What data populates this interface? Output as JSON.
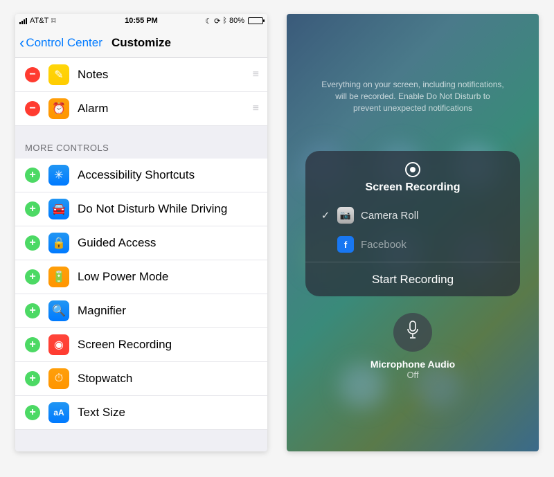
{
  "left": {
    "status": {
      "carrier": "AT&T",
      "time": "10:55 PM",
      "battery_pct": "80%"
    },
    "nav": {
      "back_label": "Control Center",
      "title": "Customize"
    },
    "included": [
      {
        "label": "Notes",
        "icon_color": "yellow",
        "glyph": "✎"
      },
      {
        "label": "Alarm",
        "icon_color": "orange",
        "glyph": "⏰"
      }
    ],
    "more_header": "MORE CONTROLS",
    "more": [
      {
        "label": "Accessibility Shortcuts",
        "icon_color": "blue",
        "glyph": "✳"
      },
      {
        "label": "Do Not Disturb While Driving",
        "icon_color": "blue",
        "glyph": "🚘"
      },
      {
        "label": "Guided Access",
        "icon_color": "blue",
        "glyph": "🔒"
      },
      {
        "label": "Low Power Mode",
        "icon_color": "orange",
        "glyph": "🔋"
      },
      {
        "label": "Magnifier",
        "icon_color": "blue",
        "glyph": "🔍"
      },
      {
        "label": "Screen Recording",
        "icon_color": "red",
        "glyph": "◉"
      },
      {
        "label": "Stopwatch",
        "icon_color": "orange",
        "glyph": "⏱"
      },
      {
        "label": "Text Size",
        "icon_color": "blue",
        "glyph": "aA"
      }
    ]
  },
  "right": {
    "hint": "Everything on your screen, including notifications, will be recorded. Enable Do Not Disturb to prevent unexpected notifications",
    "panel_title": "Screen Recording",
    "destinations": [
      {
        "label": "Camera Roll",
        "selected": true,
        "icon": "camera"
      },
      {
        "label": "Facebook",
        "selected": false,
        "icon": "facebook"
      }
    ],
    "start_label": "Start Recording",
    "mic_label": "Microphone Audio",
    "mic_state": "Off"
  }
}
